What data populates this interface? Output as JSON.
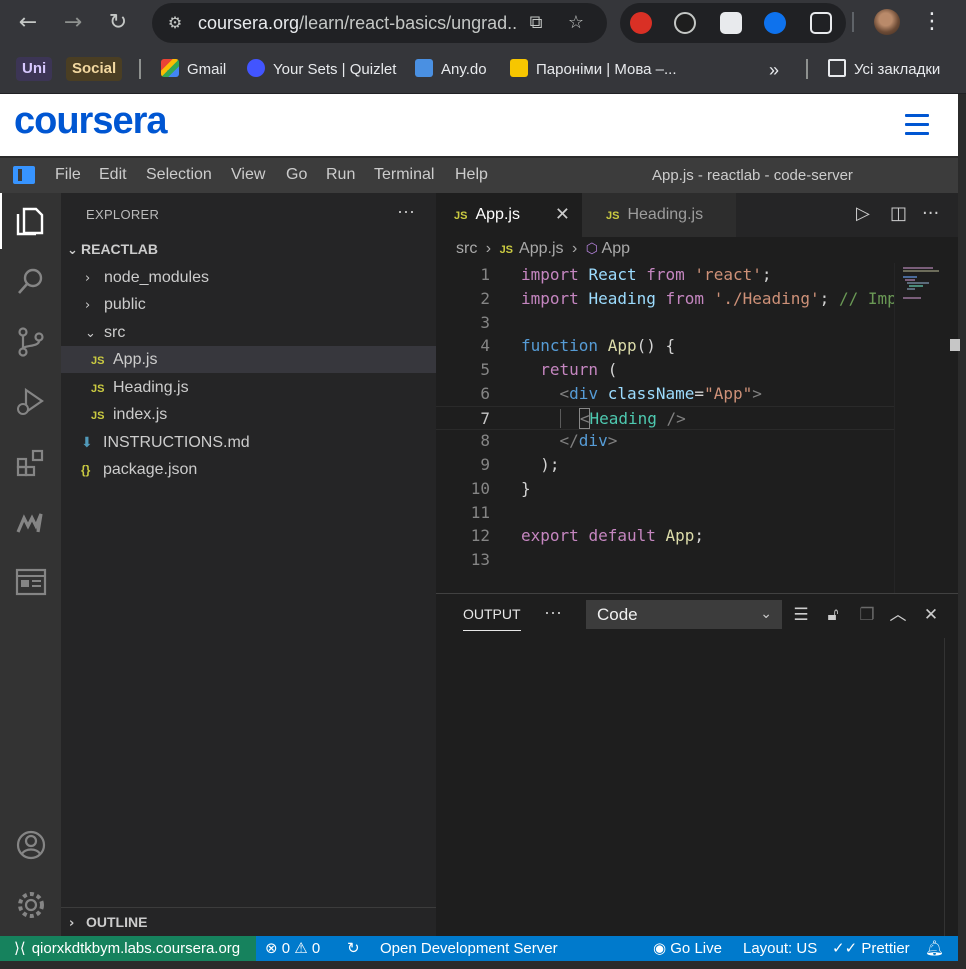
{
  "browser": {
    "url_host": "coursera.org",
    "url_path": "/learn/react-basics/ungrad...",
    "bookmarks": {
      "chip_uni": "Uni",
      "chip_social": "Social",
      "gmail": "Gmail",
      "quizlet": "Your Sets | Quizlet",
      "anydo": "Any.do",
      "paronimi": "Пароніми | Мова –...",
      "overflow": "»",
      "all_bookmarks": "Усі закладки"
    }
  },
  "coursera": {
    "logo": "coursera"
  },
  "vscode": {
    "menu": [
      "File",
      "Edit",
      "Selection",
      "View",
      "Go",
      "Run",
      "Terminal",
      "Help"
    ],
    "window_title": "App.js - reactlab - code-server",
    "explorer": {
      "header": "EXPLORER",
      "more": "···",
      "root": "REACTLAB",
      "items": {
        "node_modules": "node_modules",
        "public": "public",
        "src": "src",
        "app": "App.js",
        "heading": "Heading.js",
        "index": "index.js",
        "instructions": "INSTRUCTIONS.md",
        "package": "package.json"
      },
      "outline": "OUTLINE"
    },
    "tabs": {
      "active": "App.js",
      "inactive": "Heading.js",
      "js_badge": "JS"
    },
    "breadcrumb": {
      "folder": "src",
      "file": "App.js",
      "symbol": "App"
    },
    "code": {
      "line_numbers": [
        "1",
        "2",
        "3",
        "4",
        "5",
        "6",
        "7",
        "8",
        "9",
        "10",
        "11",
        "12",
        "13"
      ],
      "l1": {
        "kw": "import",
        "id": "React",
        "kw2": "from",
        "str": "'react'",
        "end": ";"
      },
      "l2": {
        "kw": "import",
        "id": "Heading",
        "kw2": "from",
        "str": "'./Heading'",
        "end": ";",
        "comment": "// Imp"
      },
      "l4": {
        "kw": "function",
        "fn": "App",
        "rest": "() {"
      },
      "l5": {
        "kw": "return",
        "rest": " ("
      },
      "l6": {
        "open": "<",
        "tag": "div",
        "attr": "className",
        "eq": "=",
        "val": "\"App\"",
        "close": ">"
      },
      "l7": {
        "open": "<",
        "tag": "Heading",
        "close": " />"
      },
      "l8": {
        "open": "</",
        "tag": "div",
        "close": ">"
      },
      "l9": {
        "text": ");"
      },
      "l10": {
        "text": "}"
      },
      "l12": {
        "kw": "export",
        "kw2": "default",
        "id": "App",
        "end": ";"
      }
    },
    "panel": {
      "tab": "OUTPUT",
      "more": "···",
      "select_value": "Code"
    },
    "status": {
      "remote": "qiorxkdtkbym.labs.coursera.org",
      "errors": "0",
      "warnings": "0",
      "open_server": "Open Development Server",
      "go_live": "Go Live",
      "layout": "Layout: US",
      "prettier": "Prettier"
    }
  },
  "colors": {
    "coursera_blue": "#0056d2",
    "vscode_status": "#007acc",
    "remote_green": "#16825d"
  }
}
